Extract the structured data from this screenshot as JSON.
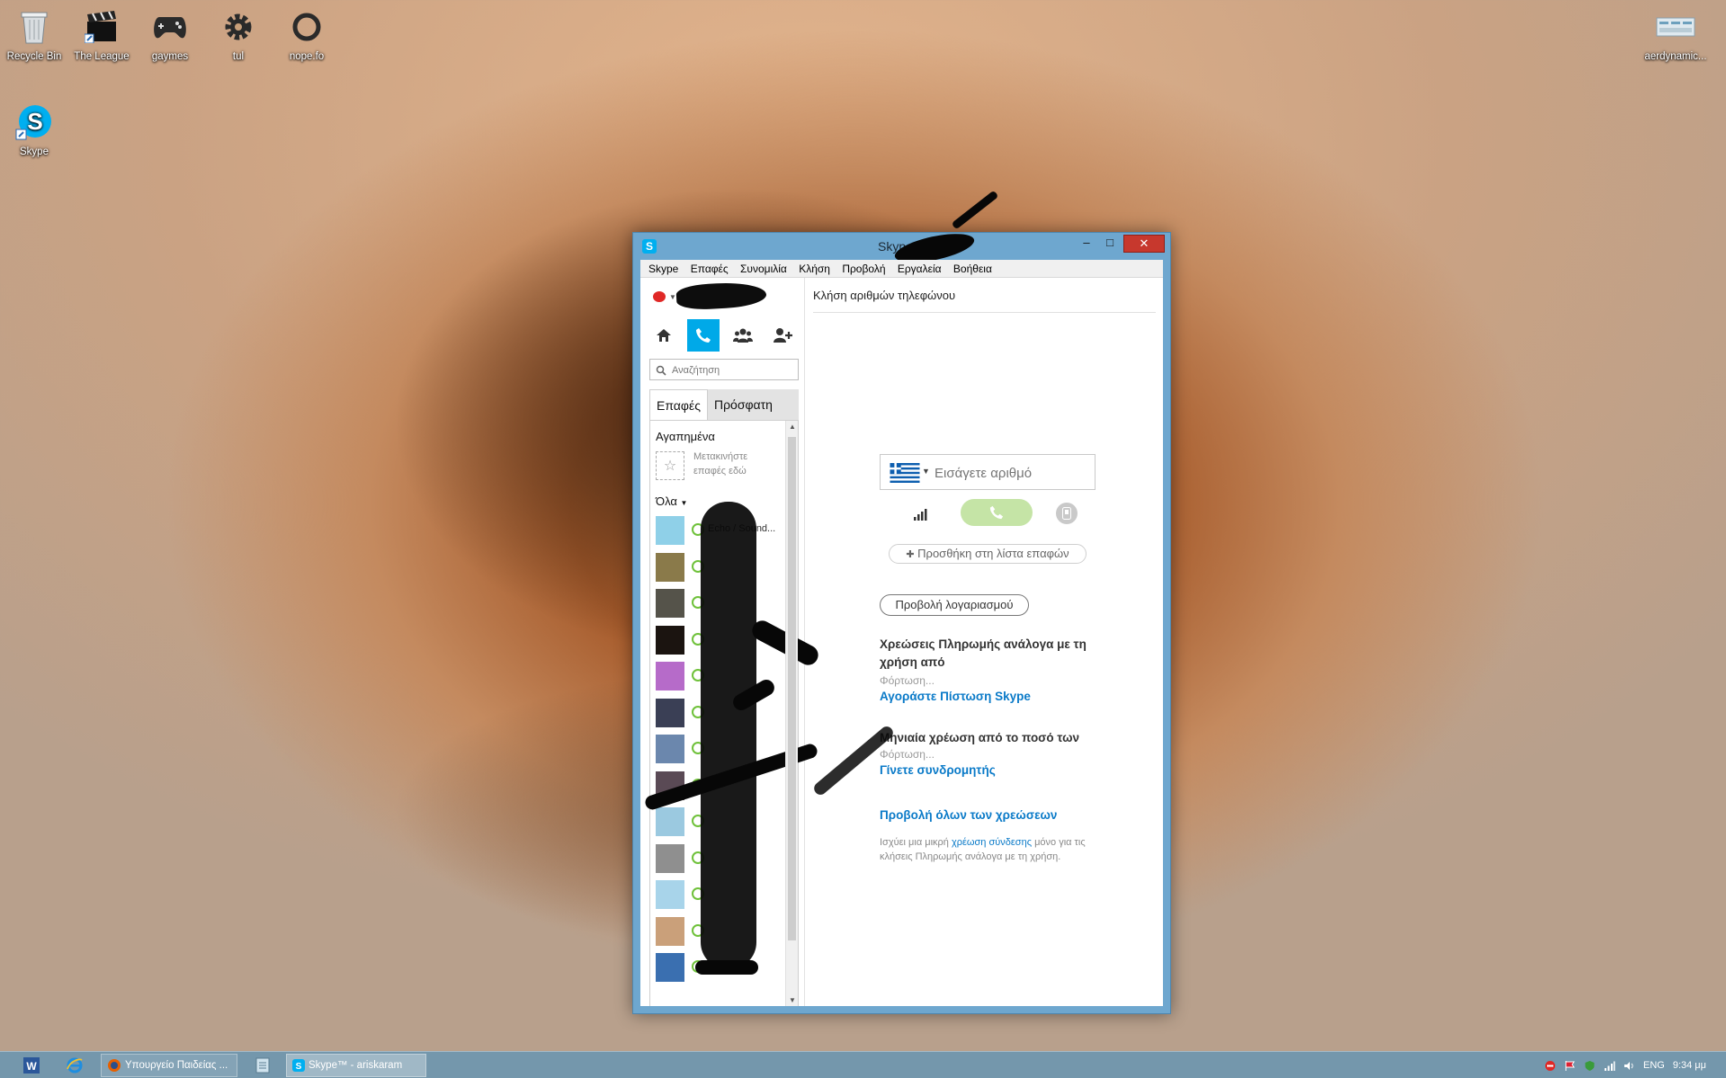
{
  "desktop": {
    "icons": [
      {
        "label": "Recycle Bin",
        "icon": "recycle-bin-icon"
      },
      {
        "label": "The League",
        "icon": "clapperboard-icon"
      },
      {
        "label": "gaymes",
        "icon": "gamepad-icon"
      },
      {
        "label": "tul",
        "icon": "gear-icon"
      },
      {
        "label": "nope.fo",
        "icon": "ring-icon"
      },
      {
        "label": "Skype",
        "icon": "skype-icon"
      },
      {
        "label": "aerdynamic...",
        "icon": "image-file-icon"
      }
    ]
  },
  "window": {
    "title": "Skype™",
    "title_suffix": "",
    "menu": [
      "Skype",
      "Επαφές",
      "Συνομιλία",
      "Κλήση",
      "Προβολή",
      "Εργαλεία",
      "Βοήθεια"
    ]
  },
  "left_pane": {
    "search_placeholder": "Αναζήτηση",
    "tabs": {
      "contacts": "Επαφές",
      "recent": "Πρόσφατη"
    },
    "favorites": {
      "heading": "Αγαπημένα",
      "hint": "Μετακινήστε επαφές εδώ"
    },
    "all_heading": "Όλα",
    "contacts": [
      {
        "name": "Echo / Sound...",
        "color": "#8fd0e8"
      },
      {
        "name": "",
        "color": "#8a7a4a"
      },
      {
        "name": "",
        "color": "#55534a"
      },
      {
        "name": "",
        "color": "#1b1410"
      },
      {
        "name": "",
        "color": "#b66bc9"
      },
      {
        "name": "",
        "color": "#3a3f55"
      },
      {
        "name": "",
        "color": "#6b87ad"
      },
      {
        "name": "",
        "color": "#5a4a55"
      },
      {
        "name": "",
        "color": "#9bc9e0"
      },
      {
        "name": "",
        "color": "#8f8f8f"
      },
      {
        "name": "",
        "color": "#a8d4ea"
      },
      {
        "name": "",
        "color": "#caa07a"
      },
      {
        "name": "",
        "color": "#3a6fb0"
      }
    ]
  },
  "right_pane": {
    "title": "Κλήση αριθμών τηλεφώνου",
    "dial_placeholder": "Εισάγετε αριθμό",
    "add_to_contacts": "Προσθήκη στη λίστα επαφών",
    "view_account": "Προβολή λογαριασμού",
    "payg": {
      "heading": "Χρεώσεις Πληρωμής ανάλογα με τη χρήση από",
      "loading": "Φόρτωση...",
      "link": "Αγοράστε Πίστωση Skype"
    },
    "monthly": {
      "heading": "Μηνιαία χρέωση από το ποσό των",
      "loading": "Φόρτωση...",
      "link": "Γίνετε συνδρομητής"
    },
    "all_rates_link": "Προβολή όλων των χρεώσεων",
    "note_prefix": "Ισχύει μια μικρή",
    "note_link": "χρέωση σύνδεσης",
    "note_suffix": "μόνο για τις κλήσεις Πληρωμής ανάλογα με τη χρήση."
  },
  "taskbar": {
    "buttons": [
      {
        "label": "Υπουργείο Παιδείας ...",
        "icon": "firefox-icon"
      },
      {
        "label": "Skype™ - ariskaram",
        "icon": "skype-icon"
      }
    ],
    "language": "ENG",
    "time": "9:34 μμ"
  },
  "colors": {
    "accent": "#00a9e8",
    "link": "#0a7ac8",
    "close": "#c7382d"
  }
}
